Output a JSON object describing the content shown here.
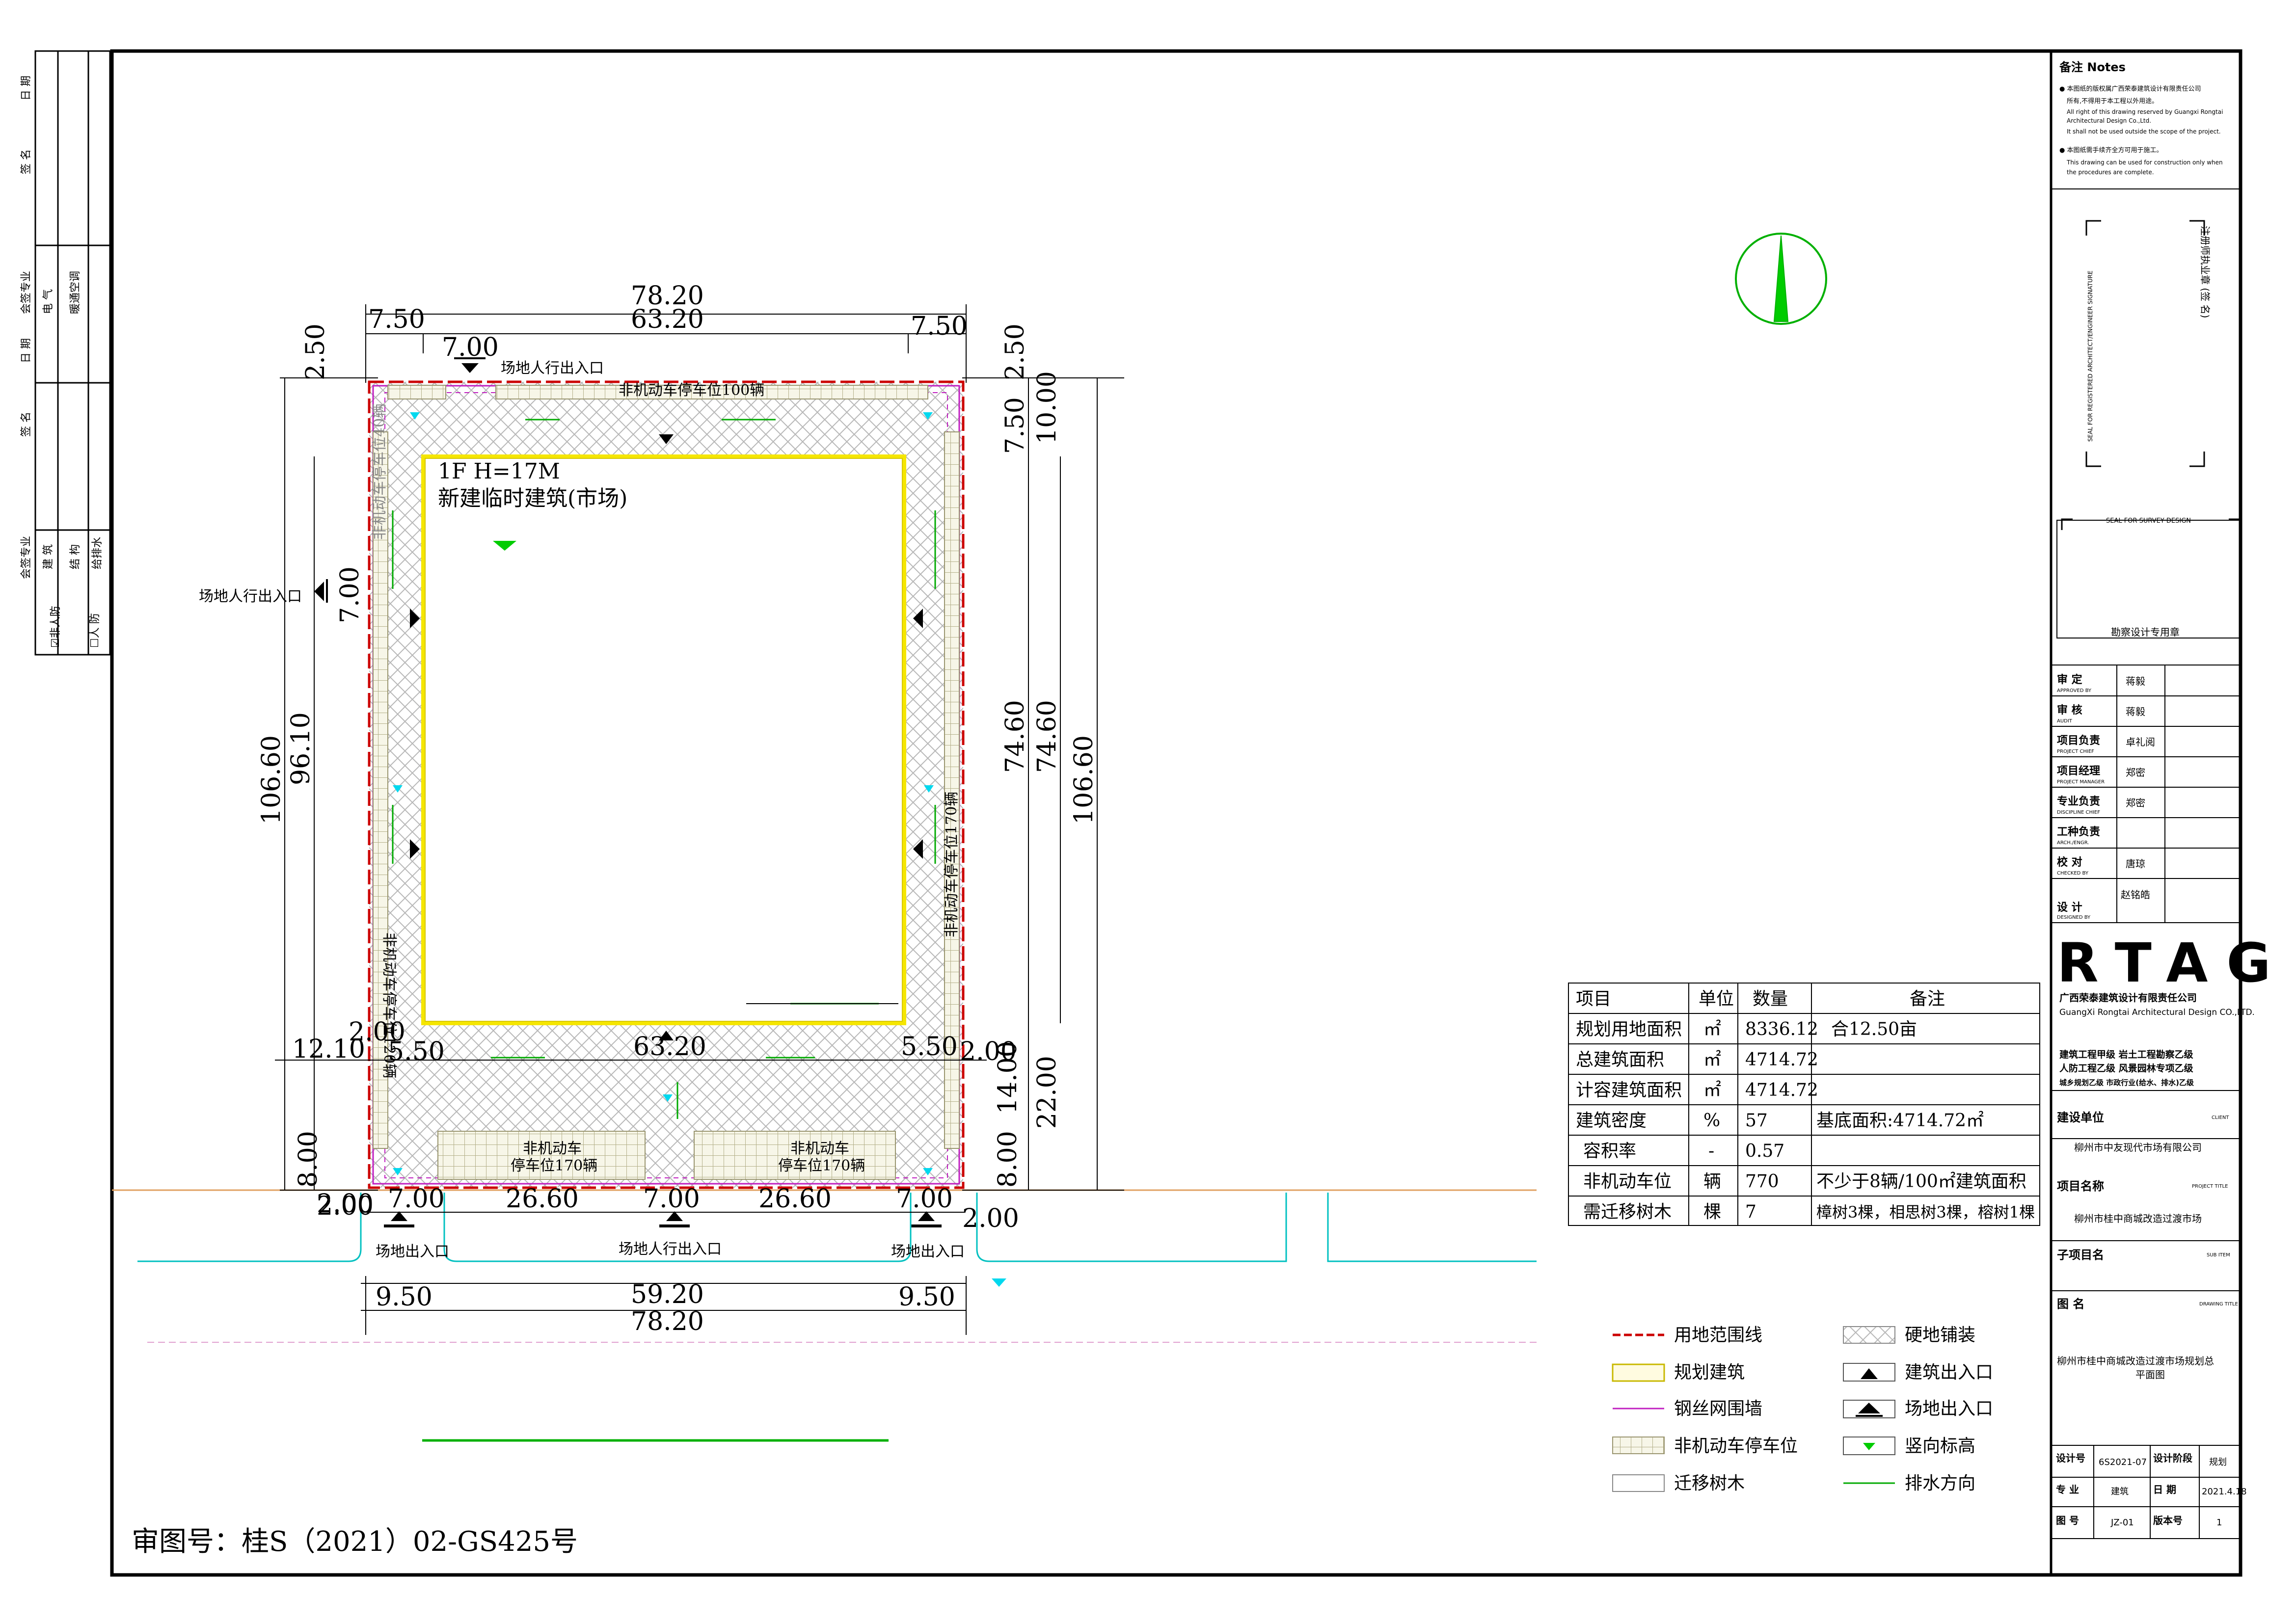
{
  "margin_strip": {
    "row1": {
      "date": "日 期",
      "sign": "签 名",
      "dept": "会签专业"
    },
    "row1_items": [
      "电 气",
      "暖通空调"
    ],
    "row2": {
      "date": "日 期",
      "sign": "签 名",
      "dept": "会签专业"
    },
    "row2_items": [
      "建 筑",
      "结 构",
      "给排水"
    ],
    "checks": [
      "☑非人防",
      "☐人 防"
    ]
  },
  "site": {
    "top_total": "78.20",
    "top_mid": "63.20",
    "top_left": "7.50",
    "top_right": "7.50",
    "top_gap": "7.00",
    "left_total": "106.60",
    "left_inner": "96.10",
    "left_top": "2.50",
    "left_gap": "7.00",
    "left_low1": "12.10",
    "left_low2": "8.00",
    "left_low3": "2.00",
    "right_top": "2.50",
    "right_a": "7.50",
    "right_b": "10.00",
    "right_c": "74.60",
    "right_d": "74.60",
    "right_total": "106.60",
    "right_e": "14.00",
    "right_f": "22.00",
    "right_g": "8.00",
    "right_h": "2.00",
    "inner_left": "5.50",
    "inner_mid": "63.20",
    "inner_right": "5.50",
    "bot_a": "7.00",
    "bot_b": "26.60",
    "bot_c": "7.00",
    "bot_d": "26.60",
    "bot_e": "7.00",
    "bot_l": "2.00",
    "bot_r": "2.00",
    "base_left": "9.50",
    "base_mid": "59.20",
    "base_right": "9.50",
    "base_total": "78.20",
    "ped_top": "场地人行出入口",
    "ped_left": "场地人行出入口",
    "ped_bottom": "场地人行出入口",
    "veh_left": "场地出入口",
    "veh_right": "场地出入口",
    "park_top": "非机动车停车位100辆",
    "park_left_top": "非机动车停车位40辆",
    "park_left": "非机动车停车位120辆",
    "park_right": "非机动车停车位170辆",
    "park_b1_l1": "非机动车",
    "park_b1_l2": "停车位170辆",
    "park_b2_l1": "非机动车",
    "park_b2_l2": "停车位170辆",
    "building_l1": "1F  H=17M",
    "building_l2": "新建临时建筑(市场)"
  },
  "table": {
    "headers": [
      "项目",
      "单位",
      "数量",
      "备注"
    ],
    "rows": [
      [
        "规划用地面积",
        "㎡",
        "8336.12",
        "合12.50亩"
      ],
      [
        "总建筑面积",
        "㎡",
        "4714.72",
        ""
      ],
      [
        "计容建筑面积",
        "㎡",
        "4714.72",
        ""
      ],
      [
        "建筑密度",
        "%",
        "57",
        "基底面积:4714.72㎡"
      ],
      [
        "容积率",
        "-",
        "0.57",
        ""
      ],
      [
        "非机动车位",
        "辆",
        "770",
        "不少于8辆/100㎡建筑面积"
      ],
      [
        "需迁移树木",
        "棵",
        "7",
        "樟树3棵，相思树3棵，榕树1棵"
      ]
    ]
  },
  "legend": [
    {
      "label": "用地范围线"
    },
    {
      "label": "硬地铺装"
    },
    {
      "label": "规划建筑"
    },
    {
      "label": "建筑出入口"
    },
    {
      "label": "钢丝网围墙"
    },
    {
      "label": "场地出入口"
    },
    {
      "label": "非机动车停车位"
    },
    {
      "label": "竖向标高"
    },
    {
      "label": "迁移树木"
    },
    {
      "label": "排水方向"
    }
  ],
  "review_no": "审图号：桂S（2021）02-GS425号",
  "title_block": {
    "notes_title": "备注 Notes",
    "note1": "● 本图纸的版权属广西荣泰建筑设计有限责任公司",
    "note1b": "所有,不得用于本工程以外用途。",
    "note1c": "All right of this drawing reserved by Guangxi Rongtai",
    "note1d": "Architectural Design Co.,Ltd.",
    "note1e": "It shall not be used outside the scope of the project.",
    "note2": "● 本图纸需手续齐全方可用于施工。",
    "note2b": "This drawing can be used for construction only when",
    "note2c": "the procedures are complete.",
    "seal_v1": "SEAL FOR REGISTERED ARCHITECT/ENGINEER   SIGNATURE",
    "seal_v2": "注册师执业章      (签 名)",
    "seal_survey": "SEAL FOR SURVEY DESIGN",
    "seal_survey_cn": "勘察设计专用章",
    "roles": [
      {
        "cn": "审    定",
        "en": "APPROVED BY",
        "name": "蒋毅"
      },
      {
        "cn": "审    核",
        "en": "AUDIT",
        "name": "蒋毅"
      },
      {
        "cn": "项目负责",
        "en": "PROJECT CHIEF",
        "name": "卓礼阅"
      },
      {
        "cn": "项目经理",
        "en": "PROJECT MANAGER",
        "name": "郑密"
      },
      {
        "cn": "专业负责",
        "en": "DISCIPLINE CHIEF",
        "name": "郑密"
      },
      {
        "cn": "工种负责",
        "en": "ARCH./ENGR.",
        "name": ""
      },
      {
        "cn": "校    对",
        "en": "CHECKED BY",
        "name": "唐琼"
      },
      {
        "cn": "设    计",
        "en": "DESIGNED BY",
        "name": "赵铭皓"
      }
    ],
    "logo": "RTAG",
    "company_cn": "广西荣泰建筑设计有限责任公司",
    "company_en": "GuangXi Rongtai Architectural Design CO.,LTD.",
    "quals": [
      "建筑工程甲级  岩土工程勘察乙级",
      "人防工程乙级  风景园林专项乙级",
      "城乡规划乙级  市政行业(给水、排水)乙级"
    ],
    "client_label": "建设单位",
    "client_en": "CLIENT",
    "client": "柳州市中友现代市场有限公司",
    "project_label": "项目名称",
    "project_en": "PROJECT TITLE",
    "project": "柳州市桂中商城改造过渡市场",
    "subitem_label": "子项目名",
    "subitem_en": "SUB ITEM",
    "drawing_label": "图    名",
    "drawing_en": "DRAWING TITLE",
    "drawing_l1": "柳州市桂中商城改造过渡市场规划总",
    "drawing_l2": "平面图",
    "job_label": "设计号",
    "job": "6S2021-07",
    "stage_label": "设计阶段",
    "stage": "规划",
    "disc_label": "专    业",
    "disc": "建筑",
    "date_label": "日    期",
    "date": "2021.4.18",
    "dwg_label": "图    号",
    "dwg": "JZ-01",
    "ver_label": "版本号",
    "ver": "1"
  }
}
